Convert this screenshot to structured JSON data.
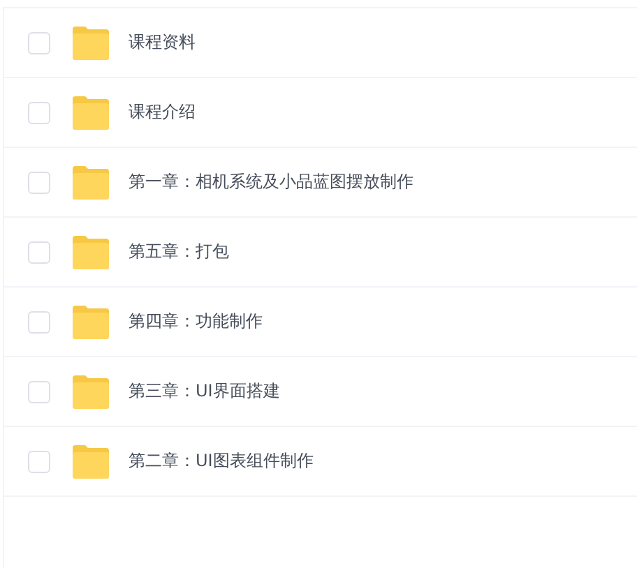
{
  "files": [
    {
      "name": "课程资料",
      "checked": false
    },
    {
      "name": "课程介绍",
      "checked": false
    },
    {
      "name": "第一章：相机系统及小品蓝图摆放制作",
      "checked": false
    },
    {
      "name": "第五章：打包",
      "checked": false
    },
    {
      "name": "第四章：功能制作",
      "checked": false
    },
    {
      "name": "第三章：UI界面搭建",
      "checked": false
    },
    {
      "name": "第二章：UI图表组件制作",
      "checked": false
    }
  ]
}
